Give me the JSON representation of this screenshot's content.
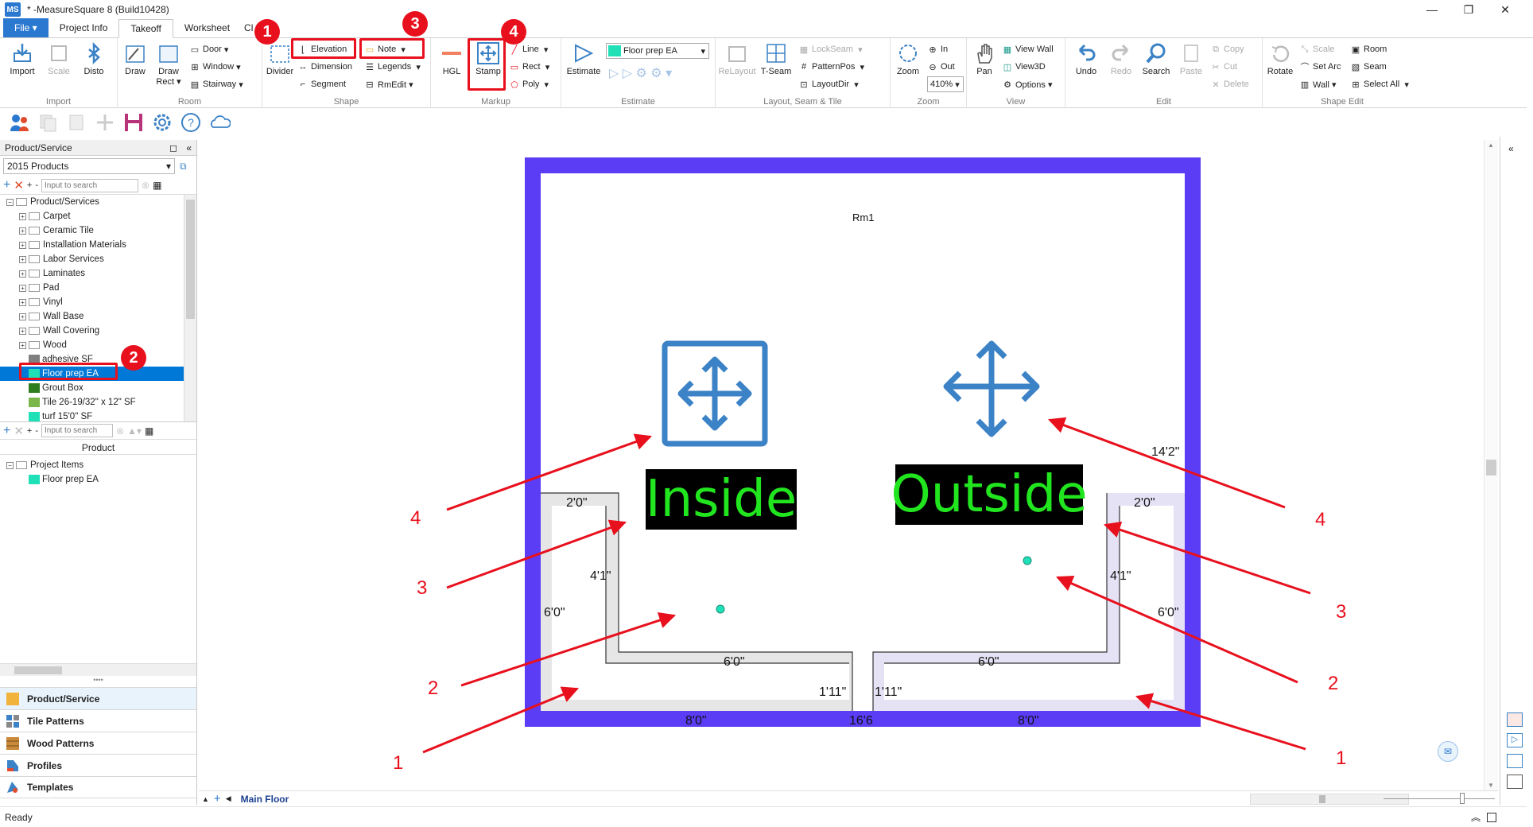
{
  "window": {
    "app_icon": "MS",
    "title": "* -MeasureSquare 8 (Build10428)",
    "minimize": "—",
    "maximize": "❐",
    "close": "✕"
  },
  "tabs": [
    {
      "label": "File ▾"
    },
    {
      "label": "Project Info"
    },
    {
      "label": "Takeoff"
    },
    {
      "label": "Worksheet"
    },
    {
      "label": "Cl"
    }
  ],
  "ribbon": {
    "import": {
      "import": "Import",
      "scale": "Scale",
      "disto": "Disto",
      "label": "Import"
    },
    "room": {
      "draw": "Draw",
      "draw_rect": "Draw Rect ▾",
      "door": "Door",
      "window": "Window",
      "stairway": "Stairway",
      "label": "Room"
    },
    "shape": {
      "divider": "Divider",
      "elevation": "Elevation",
      "note": "Note",
      "dimension": "Dimension",
      "legends": "Legends",
      "segment": "Segment",
      "rmedit": "RmEdit ▾",
      "label": "Shape"
    },
    "markup": {
      "hgl": "HGL",
      "stamp": "Stamp",
      "line": "Line",
      "rect": "Rect",
      "poly": "Poly",
      "label": "Markup"
    },
    "estimate": {
      "estimate": "Estimate",
      "product_select": "Floor prep  EA",
      "label": "Estimate"
    },
    "layout": {
      "relayout": "ReLayout",
      "tseam": "T-Seam",
      "lockseam": "LockSeam",
      "patternpos": "PatternPos",
      "layoutdir": "LayoutDir",
      "label": "Layout, Seam & Tile"
    },
    "zoom": {
      "zoom": "Zoom",
      "in": "In",
      "out": "Out",
      "level": "410%",
      "label": "Zoom"
    },
    "view": {
      "pan": "Pan",
      "view_wall": "View Wall",
      "view3d": "View3D",
      "options": "Options ▾",
      "label": "View"
    },
    "edit": {
      "undo": "Undo",
      "redo": "Redo",
      "search": "Search",
      "paste": "Paste",
      "copy": "Copy",
      "cut": "Cut",
      "delete": "Delete",
      "label": "Edit"
    },
    "shape_edit": {
      "rotate": "Rotate",
      "scale": "Scale",
      "set_arc": "Set Arc",
      "wall": "Wall ▾",
      "room": "Room",
      "seam": "Seam",
      "select_all": "Select All",
      "label": "Shape Edit"
    }
  },
  "badges": {
    "one": "1",
    "two": "2",
    "three": "3",
    "four": "4"
  },
  "left_panel": {
    "title": "Product/Service",
    "pin": "◻",
    "collapse": "«",
    "catalog": "2015 Products",
    "search_placeholder": "Input to search",
    "tree_root": "Product/Services",
    "categories": [
      "Carpet",
      "Ceramic Tile",
      "Installation Materials",
      "Labor Services",
      "Laminates",
      "Pad",
      "Vinyl",
      "Wall Base",
      "Wall Covering",
      "Wood"
    ],
    "products": [
      {
        "name": "adhesive  SF",
        "color": "#7f7f7f"
      },
      {
        "name": "Floor prep  EA",
        "color": "#20e0b8"
      },
      {
        "name": "Grout Box",
        "color": "#2e7d1e"
      },
      {
        "name": "Tile 26-19/32\" x 12\" SF",
        "color": "#7ab648"
      },
      {
        "name": "turf 15'0\" SF",
        "color": "#20e0b8"
      }
    ],
    "product_header": "Product",
    "project_root": "Project Items",
    "project_items": [
      {
        "name": "Floor prep  EA",
        "color": "#20e0b8"
      }
    ],
    "nav": [
      "Product/Service",
      "Tile Patterns",
      "Wood Patterns",
      "Profiles",
      "Templates"
    ]
  },
  "canvas": {
    "room_name": "Rm1",
    "inside_label": "Inside",
    "outside_label": "Outside",
    "dims": {
      "top_right": "14'2\"",
      "l_top": "2'0\"",
      "l_inner": "4'1\"",
      "l_outer": "6'0\"",
      "l_mid": "6'0\"",
      "l_step": "1'11\"",
      "l_bottom": "8'0\"",
      "gap": "16'6",
      "r_top": "2'0\"",
      "r_inner": "4'1\"",
      "r_outer": "6'0\"",
      "r_mid": "6'0\"",
      "r_step": "1'11\"",
      "r_bottom": "8'0\""
    },
    "arrow_numbers": {
      "l4": "4",
      "l3": "3",
      "l2": "2",
      "l1": "1",
      "r4": "4",
      "r3": "3",
      "r2": "2",
      "r1": "1"
    },
    "colors": {
      "wall": "#5b3df5",
      "arrow": "#e8101d",
      "stamp": "#3b82c6",
      "label_text": "#21e51e",
      "marker": "#20e0b8"
    }
  },
  "sheet_tab": "Main Floor",
  "status": "Ready"
}
